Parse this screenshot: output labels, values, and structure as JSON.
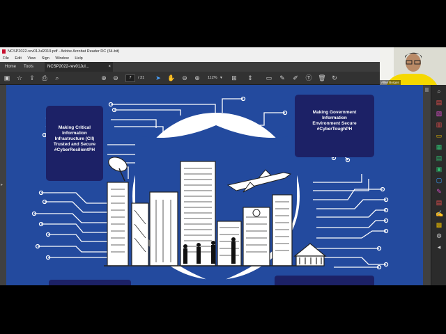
{
  "window": {
    "title": "NCSP2022-rev01Jul2019.pdf - Adobe Acrobat Reader DC (64-bit)",
    "menu": [
      "File",
      "Edit",
      "View",
      "Sign",
      "Window",
      "Help"
    ],
    "tabs": [
      {
        "label": "Home"
      },
      {
        "label": "Tools"
      },
      {
        "label": "NCSP2022-rev01Jul..."
      }
    ],
    "close_glyph": "×"
  },
  "toolbar": {
    "current_page": "7",
    "total_pages": "/ 31",
    "zoom": "112%",
    "zoom_arrow": "▾"
  },
  "document": {
    "boxes": [
      {
        "lines": [
          "Making Critical",
          "Information",
          "Infrastructure (CII)",
          "Trusted and Secure",
          "#CyberResilientPH"
        ]
      },
      {
        "lines": [
          "Making Government",
          "Information",
          "Environment Secure",
          "#CyberToughPH"
        ]
      }
    ]
  },
  "webcam": {
    "name": "Allan Borgos"
  },
  "colors": {
    "page_blue": "#234a9e",
    "navy_box": "#1c2166",
    "circuit": "#ffffff",
    "accent": "#f5d800"
  }
}
